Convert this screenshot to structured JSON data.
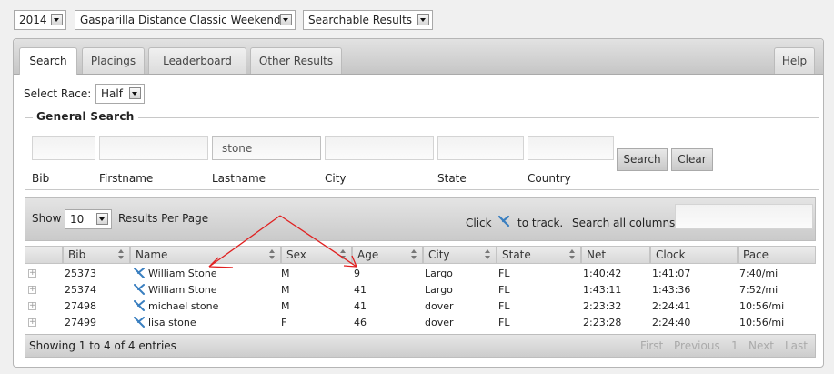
{
  "top_selects": [
    {
      "value": "2014"
    },
    {
      "value": "Gasparilla Distance Classic Weekend"
    },
    {
      "value": "Searchable Results"
    }
  ],
  "tabs": [
    "Search",
    "Placings",
    "Leaderboard",
    "Other Results"
  ],
  "help_label": "Help",
  "select_race": {
    "label": "Select Race:",
    "value": "Half"
  },
  "general_search": {
    "legend": "General Search",
    "fields": [
      {
        "label": "Bib",
        "value": ""
      },
      {
        "label": "Firstname",
        "value": ""
      },
      {
        "label": "Lastname",
        "value": "stone"
      },
      {
        "label": "City",
        "value": ""
      },
      {
        "label": "State",
        "value": ""
      },
      {
        "label": "Country",
        "value": ""
      }
    ],
    "search_button": "Search",
    "clear_button": "Clear"
  },
  "table_controls": {
    "show_label": "Show",
    "per_page": "10",
    "per_page_suffix": "Results Per Page",
    "click_label": "Click",
    "track_label": "to track.",
    "search_all_label": "Search all columns",
    "search_all_value": ""
  },
  "columns": [
    "Bib",
    "Name",
    "Sex",
    "Age",
    "City",
    "State",
    "Net",
    "Clock",
    "Pace"
  ],
  "rows": [
    {
      "bib": "25373",
      "name": "William Stone",
      "sex": "M",
      "age": "9",
      "city": "Largo",
      "state": "FL",
      "net": "1:40:42",
      "clock": "1:41:07",
      "pace": "7:40/mi"
    },
    {
      "bib": "25374",
      "name": "William Stone",
      "sex": "M",
      "age": "41",
      "city": "Largo",
      "state": "FL",
      "net": "1:43:11",
      "clock": "1:43:36",
      "pace": "7:52/mi"
    },
    {
      "bib": "27498",
      "name": "michael stone",
      "sex": "M",
      "age": "41",
      "city": "dover",
      "state": "FL",
      "net": "2:23:32",
      "clock": "2:24:41",
      "pace": "10:56/mi"
    },
    {
      "bib": "27499",
      "name": "lisa stone",
      "sex": "F",
      "age": "46",
      "city": "dover",
      "state": "FL",
      "net": "2:23:28",
      "clock": "2:24:40",
      "pace": "10:56/mi"
    }
  ],
  "footer": {
    "info": "Showing 1 to 4 of 4 entries",
    "pagination": [
      "First",
      "Previous",
      "1",
      "Next",
      "Last"
    ]
  },
  "colors": {
    "annotation": "#e02020",
    "track_icon": "#3a7fc0"
  }
}
